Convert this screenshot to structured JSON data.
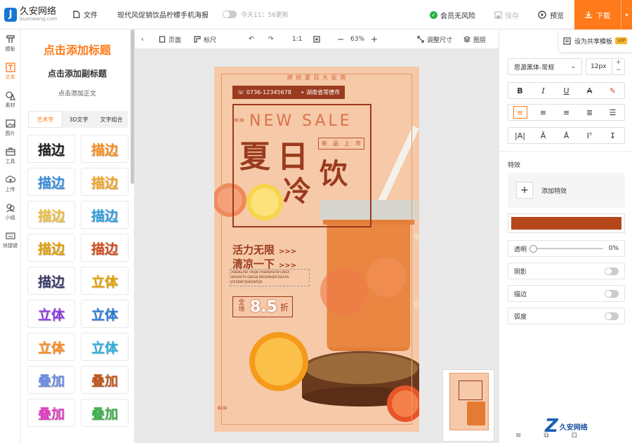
{
  "app": {
    "logo_name": "久安网络",
    "logo_url": "buanwang.com"
  },
  "header": {
    "file_label": "文件",
    "doc_title": "现代风促销饮品柠檬手机海报",
    "save_status": "今天11：56更新",
    "member_label": "会员无风险",
    "save_label": "保存",
    "preview_label": "预览",
    "download_label": "下载"
  },
  "leftnav": [
    {
      "label": "模板",
      "icon": "template-icon"
    },
    {
      "label": "文本",
      "icon": "text-icon",
      "active": true
    },
    {
      "label": "素材",
      "icon": "material-icon"
    },
    {
      "label": "图片",
      "icon": "image-icon"
    },
    {
      "label": "工具",
      "icon": "toolbox-icon"
    },
    {
      "label": "上传",
      "icon": "upload-icon"
    },
    {
      "label": "小组",
      "icon": "group-icon"
    },
    {
      "label": "快捷键",
      "icon": "keyboard-icon"
    }
  ],
  "text_panel": {
    "add_title": "点击添加标题",
    "add_subtitle": "点击添加副标题",
    "add_body": "点击添加正文",
    "tabs": [
      "艺术字",
      "3D文字",
      "文字组合"
    ],
    "tiles": [
      {
        "text": "描边",
        "color": "#222222"
      },
      {
        "text": "描边",
        "color": "#ff8c1a"
      },
      {
        "text": "描边",
        "color": "#3a8de0"
      },
      {
        "text": "描边",
        "color": "#f5a623"
      },
      {
        "text": "描边",
        "color": "#f0c040"
      },
      {
        "text": "描边",
        "color": "#2d9fe0"
      },
      {
        "text": "描边",
        "color": "#e0a000"
      },
      {
        "text": "描边",
        "color": "#d84a1a"
      },
      {
        "text": "描边",
        "color": "#3a3a6a"
      },
      {
        "text": "立体",
        "color": "#e5a100"
      },
      {
        "text": "立体",
        "color": "#8a3ae0"
      },
      {
        "text": "立体",
        "color": "#2a7ad8"
      },
      {
        "text": "立体",
        "color": "#ff8a1a"
      },
      {
        "text": "立体",
        "color": "#2ab0e0"
      },
      {
        "text": "叠加",
        "color": "#6a8ae0"
      },
      {
        "text": "叠加",
        "color": "#c0541a"
      },
      {
        "text": "叠加",
        "color": "#e03ac0"
      },
      {
        "text": "叠加",
        "color": "#3ab04a"
      }
    ]
  },
  "toolbar": {
    "page_label": "页面",
    "ruler_label": "标尺",
    "ratio_label": "1:1",
    "zoom": "63%",
    "resize_label": "调整尺寸",
    "layers_label": "图层"
  },
  "poster": {
    "top_text": "缤 纷 夏 日 大 促 销",
    "phone": "0736-12345678",
    "address": "湖南省常德市",
    "new_sale": "NEW SALE",
    "title_chars": [
      "夏",
      "日",
      "冷",
      "饮"
    ],
    "tag_chars": [
      "新",
      "品",
      "上",
      "市"
    ],
    "slogan1": "活力无限",
    "slogan2": "清凉一下",
    "arrows": ">>>",
    "small_lines": [
      "ASDJKLASF FASJK FASDKJASFW QOEA",
      "WEQAFFS QDGHJ WEQAKHJSFQEAAS",
      "JFESDKFQOEEWFQE"
    ],
    "discount_prefix": "全场",
    "discount_value": "8.5",
    "discount_unit": "折"
  },
  "right_panel": {
    "share_label": "设为共享模板",
    "vip_label": "VIP",
    "font_name": "思源黑体-常规",
    "font_size": "12px",
    "effects_label": "特效",
    "add_effect_label": "添加特效",
    "color": "#b5471a",
    "opacity_label": "透明",
    "opacity_value": "0%",
    "shadow_label": "阴影",
    "stroke_label": "描边",
    "curve_label": "弧度"
  },
  "watermark": {
    "text": "久安网络"
  }
}
